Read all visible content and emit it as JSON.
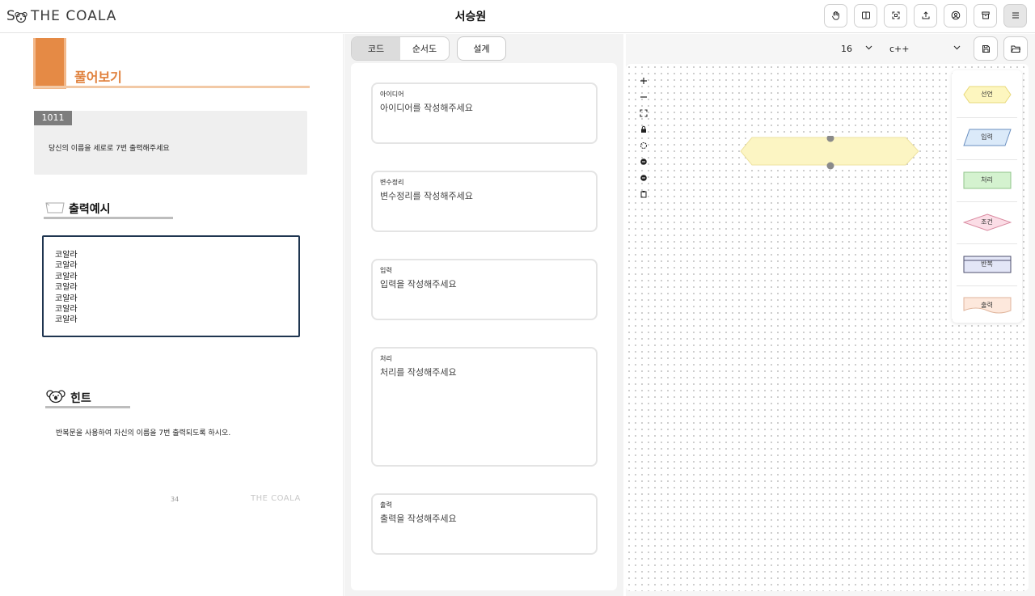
{
  "header": {
    "logo_text": "THE COALA",
    "title": "서승원",
    "actions": [
      "hand-icon",
      "split-view-icon",
      "fullscreen-icon",
      "upload-icon",
      "user-circle-icon",
      "archive-icon",
      "menu-icon"
    ]
  },
  "document": {
    "heading": "풀어보기",
    "problem_number": "1011",
    "problem_text": "당신의 이름을 세로로 7번 출력해주세요",
    "output_title": "출력예시",
    "output_lines": [
      "코알라",
      "코알라",
      "코알라",
      "코알라",
      "코알라",
      "코알라",
      "코알라"
    ],
    "hint_title": "힌트",
    "hint_text": "반복문을 사용하여 자신의 이름을 7번 출력되도록 하시오.",
    "page_number": "34",
    "footer_logo": "THE COALA"
  },
  "editor": {
    "tabs": [
      {
        "label": "코드",
        "active": true
      },
      {
        "label": "순서도",
        "active": false
      }
    ],
    "design_label": "설계",
    "fields": [
      {
        "label": "아이디어",
        "placeholder": "아이디어를 작성해주세요"
      },
      {
        "label": "변수정리",
        "placeholder": "변수정리를 작성해주세요"
      },
      {
        "label": "입력",
        "placeholder": "입력을 작성해주세요"
      },
      {
        "label": "처리",
        "placeholder": "처리를 작성해주세요"
      },
      {
        "label": "출력",
        "placeholder": "출력을 작성해주세요"
      }
    ]
  },
  "canvas": {
    "font_size": "16",
    "language": "c++",
    "controls": [
      "zoom-in-icon",
      "zoom-out-icon",
      "fit-view-icon",
      "lock-icon",
      "reset-icon",
      "rotate-icon",
      "rotate-back-icon",
      "clipboard-icon"
    ],
    "palette": [
      {
        "label": "선언",
        "color": "#fdf6bf",
        "stroke": "#e8d97a"
      },
      {
        "label": "입력",
        "color": "#dbeaf9",
        "stroke": "#6a8fc0"
      },
      {
        "label": "처리",
        "color": "#d4f2cf",
        "stroke": "#8fc488"
      },
      {
        "label": "조건",
        "color": "#fbdde6",
        "stroke": "#d98aa0"
      },
      {
        "label": "반복",
        "color": "#e3e6f7",
        "stroke": "#4c4f6e"
      },
      {
        "label": "출력",
        "color": "#fde8dc",
        "stroke": "#e0b59c"
      }
    ],
    "start_node_color": "#fcf5c3"
  }
}
